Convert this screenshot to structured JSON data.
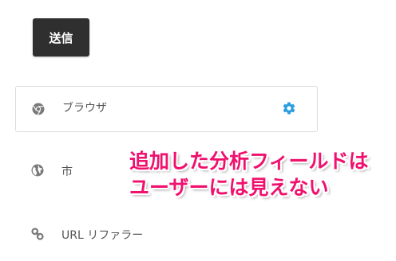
{
  "submit_button": {
    "label": "送信"
  },
  "fields": [
    {
      "label": "ブラウザ",
      "icon": "chrome-icon"
    },
    {
      "label": "市",
      "icon": "globe-icon"
    },
    {
      "label": "URL リファラー",
      "icon": "link-icon"
    }
  ],
  "annotation": {
    "line1": "追加した分析フィールドは",
    "line2": "ユーザーには見えない"
  },
  "colors": {
    "button_bg": "#2f2f2f",
    "gear": "#2d9ee0",
    "annotation": "#f0106e",
    "icon": "#7a7a7a"
  }
}
